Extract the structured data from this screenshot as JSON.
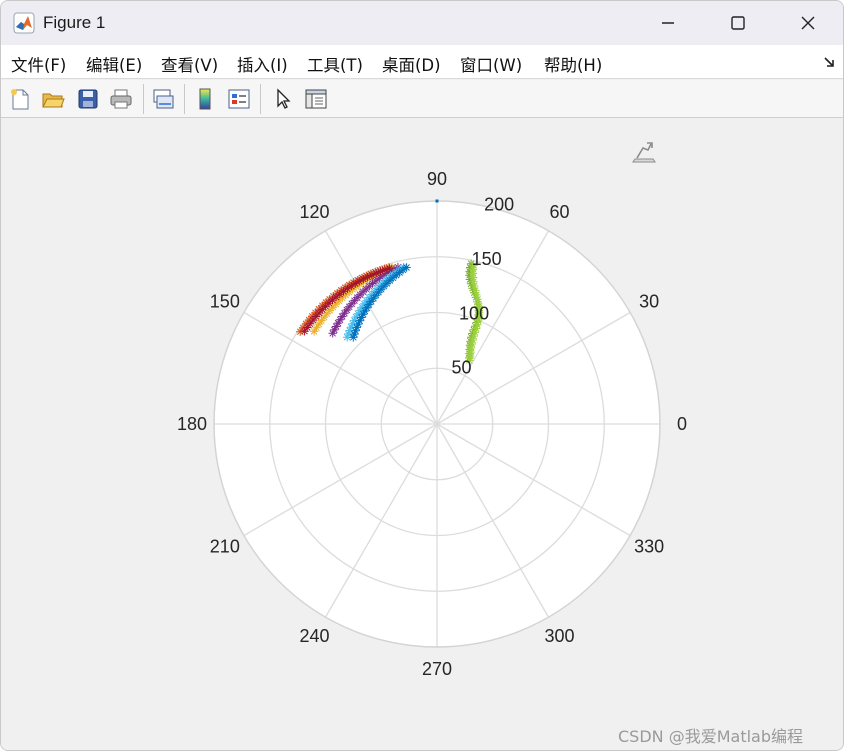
{
  "window": {
    "title": "Figure 1",
    "controls": {
      "minimize": "minimize-icon",
      "maximize": "maximize-icon",
      "close": "close-icon"
    }
  },
  "menubar": {
    "items": [
      {
        "label": "文件(F)"
      },
      {
        "label": "编辑(E)"
      },
      {
        "label": "查看(V)"
      },
      {
        "label": "插入(I)"
      },
      {
        "label": "工具(T)"
      },
      {
        "label": "桌面(D)"
      },
      {
        "label": "窗口(W)"
      },
      {
        "label": "帮助(H)"
      }
    ]
  },
  "toolbar": {
    "icons": [
      "new-figure-icon",
      "open-file-icon",
      "save-icon",
      "print-icon",
      "link-plot-icon",
      "colorbar-icon",
      "legend-icon",
      "pointer-icon",
      "property-inspector-icon"
    ]
  },
  "chart_data": {
    "type": "polar-scatter-line",
    "theta_ticks": [
      "0",
      "30",
      "60",
      "90",
      "120",
      "150",
      "180",
      "210",
      "240",
      "270",
      "300",
      "330"
    ],
    "r_ticks": [
      "50",
      "100",
      "150",
      "200"
    ],
    "rlim": [
      0,
      200
    ],
    "grid": true,
    "marker": "*",
    "series": [
      {
        "color": "#d95319",
        "theta_start": 146,
        "theta_end": 107,
        "r_start": 148,
        "r_end": 147,
        "points": 24
      },
      {
        "color": "#edb120",
        "theta_start": 143,
        "theta_end": 106,
        "r_start": 138,
        "r_end": 146,
        "points": 24
      },
      {
        "color": "#7e2f8e",
        "theta_start": 139,
        "theta_end": 104,
        "r_start": 124,
        "r_end": 145,
        "points": 24
      },
      {
        "color": "#4dbeee",
        "theta_start": 136,
        "theta_end": 102,
        "r_start": 112,
        "r_end": 144,
        "points": 24
      },
      {
        "color": "#0072bd",
        "theta_start": 134,
        "theta_end": 101,
        "r_start": 108,
        "r_end": 143,
        "points": 24
      },
      {
        "color": "#a2142f",
        "theta_start": 145,
        "theta_end": 107,
        "r_start": 145,
        "r_end": 146,
        "points": 24
      },
      {
        "color": "#77ac30",
        "theta_start": 64,
        "theta_end": 78,
        "r_start": 66,
        "r_end": 147,
        "points": 24,
        "wave": 6
      },
      {
        "color": "#9bd13d",
        "theta_start": 63,
        "theta_end": 77,
        "r_start": 64,
        "r_end": 146,
        "points": 24,
        "wave": 4
      }
    ]
  },
  "axes_toolbar": {
    "icon": "axes-export-icon"
  },
  "watermark": {
    "text": "CSDN @我爱Matlab编程"
  }
}
